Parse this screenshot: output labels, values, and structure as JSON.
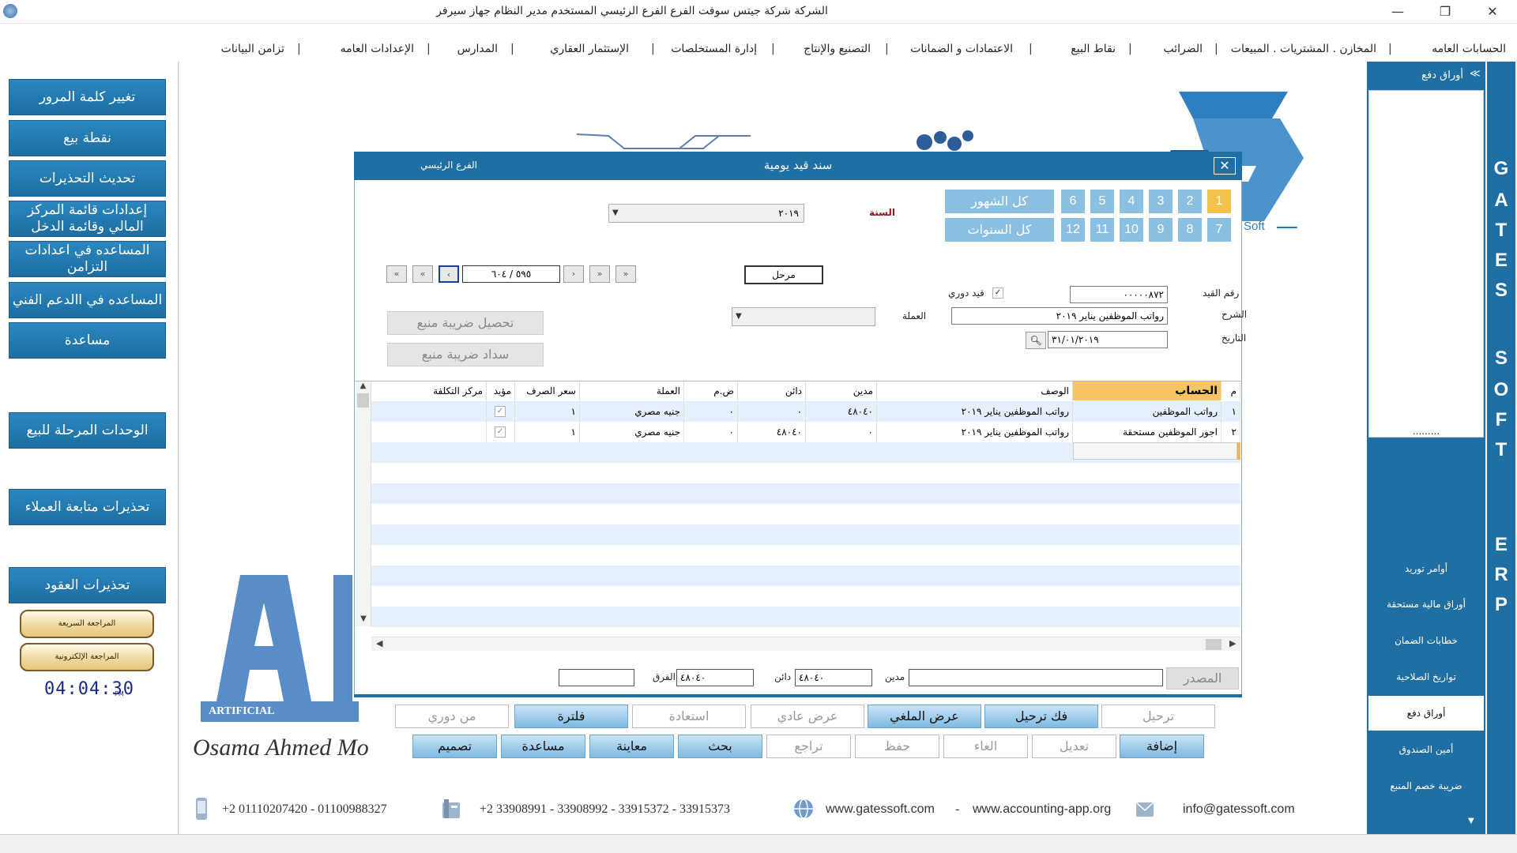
{
  "titlebar": {
    "title": "الشركة شركة جيتس سوفت   الفرع الفرع الرئيسي   المستخدم مدير النظام  جهاز سيرفر",
    "minimize": "—",
    "restore": "❐",
    "close": "✕"
  },
  "menu": [
    "الحسابات العامه",
    "المخازن . المشتريات . المبيعات",
    "الضرائب",
    "نقاط البيع",
    "الاعتمادات و الضمانات",
    "التصنيع والإنتاج",
    "إدارة المستخلصات",
    "الإستثمار العقاري",
    "المدارس",
    "الإعدادات العامه",
    "تزامن البيانات"
  ],
  "left_buttons": [
    "تغيير كلمة المرور",
    "نقطة بيع",
    "تحديث التحذيرات",
    "إعدادات قائمة المركز المالي وقائمة الدخل",
    "المساعده في اعدادات التزامن",
    "المساعده في االدعم الفني",
    "مساعدة",
    "الوحدات المرحلة للبيع",
    "تحذيرات متابعة العملاء",
    "تحذيرات العقود"
  ],
  "gold_buttons": [
    "المراجعة السريعة",
    "المراجعة الإلكترونية"
  ],
  "clock": {
    "time": "04:04:30",
    "ampm": "PM"
  },
  "right_panel": {
    "header": "أوراق دفع",
    "collapse": "≫",
    "more": ".........",
    "items": [
      "أوامر توريد",
      "أوراق مالية مستحقة",
      "خطابات الضمان",
      "تواريخ الصلاحية",
      "أوراق دفع",
      "أمين الصندوق",
      "ضريبة خصم المنبع"
    ],
    "active_index": 4
  },
  "strip_letters": [
    "G",
    "A",
    "T",
    "E",
    "S",
    "S",
    "O",
    "F",
    "T",
    "E",
    "R",
    "P"
  ],
  "logo": {
    "ai_text": "ARTIFICIAL INTELLIGENCE",
    "signature": "Osama Ahmed Mo",
    "soft_text": "Soft"
  },
  "footer": {
    "mobile": "+2 01110207420  - 01100988327",
    "phones": "+2 33908991 - 33908992 - 33915372 - 33915373",
    "website1": "www.gatessoft.com",
    "dash": "-",
    "website2": "www.accounting-app.org",
    "email": "info@gatessoft.com"
  },
  "dialog": {
    "title": "سند قيد يومية",
    "branch": "الفرع الرئيسي",
    "close": "✕",
    "months_row1": [
      "1",
      "2",
      "3",
      "4",
      "5",
      "6"
    ],
    "months_row2": [
      "7",
      "8",
      "9",
      "10",
      "11",
      "12"
    ],
    "selected_month": "1",
    "all_months": "كل الشهور",
    "all_years": "كل السنوات",
    "year_label": "السنة",
    "year_value": "٢٠١٩",
    "status": "مرحل",
    "nav": {
      "first": "«",
      "prev10": "«",
      "prev": "‹",
      "position": "٥٩٥ / ٦٠٤",
      "next": "›",
      "next10": "»",
      "last": "»"
    },
    "entry_no_label": "رقم القيد",
    "entry_no": "٠٠٠٠٠٨٧٢",
    "periodic_label": "قيد دوري",
    "periodic_checked": true,
    "desc_label": "الشرح",
    "description": "رواتب الموظفين يناير ٢٠١٩",
    "date_label": "التاريخ",
    "date": "٣١/٠١/٢٠١٩",
    "currency_label": "العملة",
    "currency_value": "",
    "tax_collect": "تحصيل ضريبة منبع",
    "tax_pay": "سداد ضريبة منبع",
    "grid": {
      "headers": [
        "م",
        "الحساب",
        "الوصف",
        "مدين",
        "دائن",
        "ض.م",
        "العملة",
        "سعر الصرف",
        "مؤيد",
        "مركز التكلفة"
      ],
      "rows": [
        [
          "١",
          "رواتب الموظفين",
          "رواتب الموظفين يناير ٢٠١٩",
          "٤٨٠٤٠",
          "٠",
          "٠",
          "جنيه مصري",
          "١",
          "✓",
          ""
        ],
        [
          "٢",
          "اجور الموظفين مستحقة",
          "رواتب الموظفين يناير ٢٠١٩",
          "٠",
          "٤٨٠٤٠",
          "٠",
          "جنيه مصري",
          "١",
          "✓",
          ""
        ]
      ]
    },
    "source_label": "المصدر",
    "debit_label": "مدين",
    "debit_total": "٤٨٠٤٠",
    "credit_label": "دائن",
    "credit_total": "٤٨٠٤٠",
    "diff_label": "الفرق",
    "diff_value": "",
    "actions_row1": [
      "ترحيل",
      "فك ترحيل",
      "عرض الملغي",
      "عرض عادي",
      "استعادة",
      "فلترة",
      "من دوري"
    ],
    "actions_row2": [
      "إضافة",
      "تعديل",
      "الغاء",
      "حفظ",
      "تراجع",
      "بحث",
      "معاينة",
      "مساعدة",
      "تصميم"
    ]
  }
}
